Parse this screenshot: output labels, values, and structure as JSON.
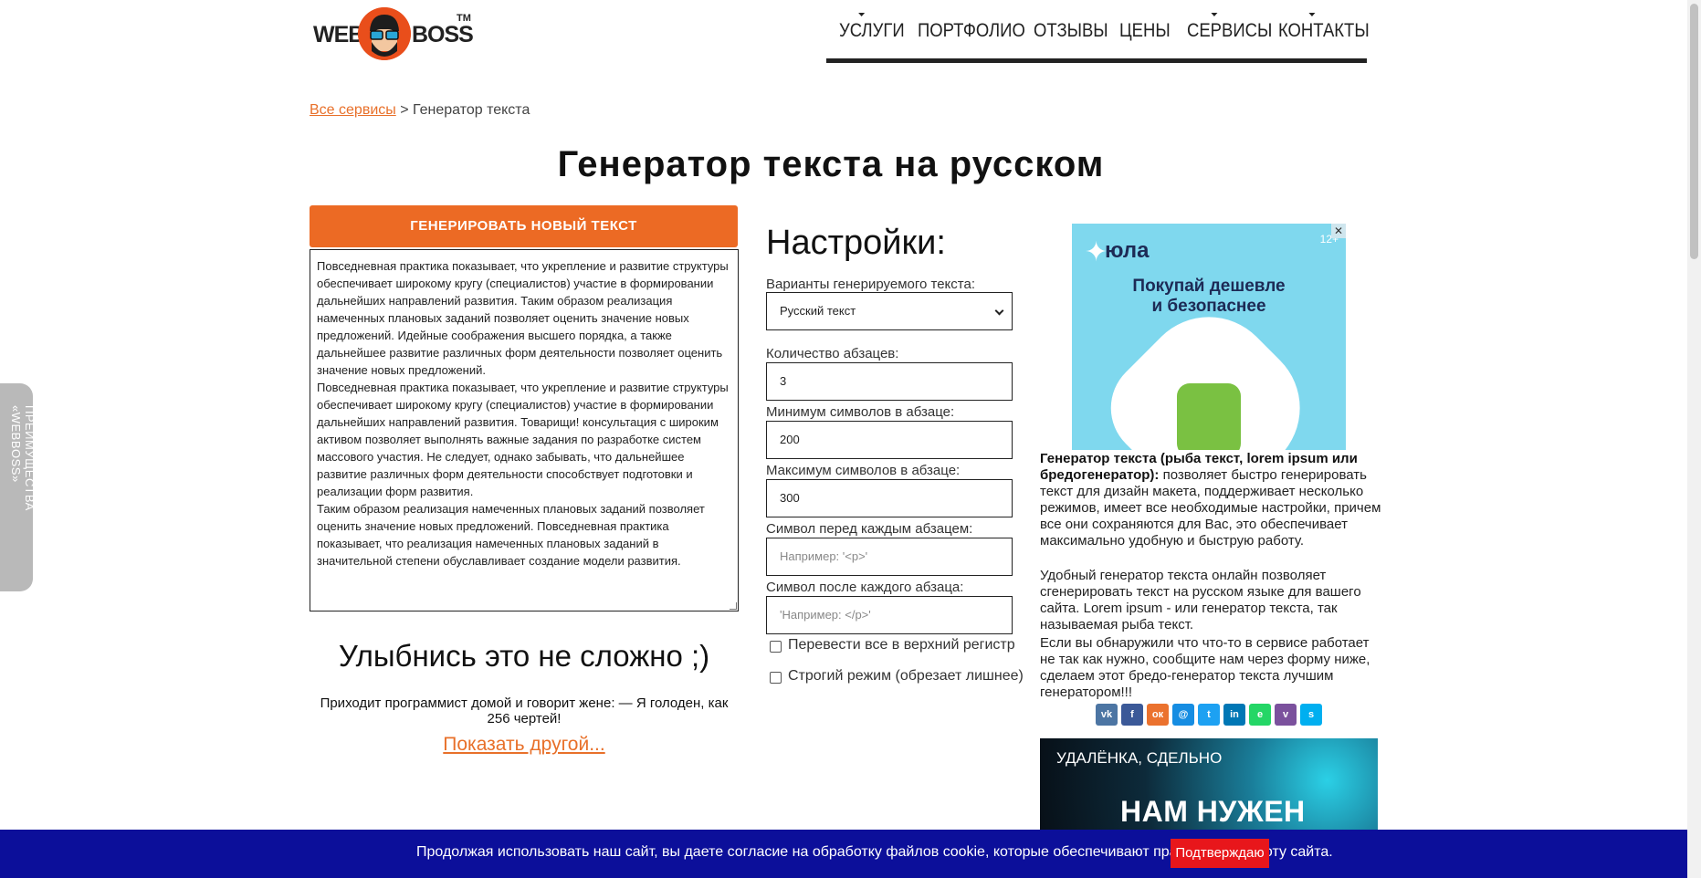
{
  "header": {
    "logo_left": "WEB",
    "logo_right": "BOSS",
    "logo_tm": "TM",
    "nav": [
      {
        "label": "УСЛУГИ",
        "has_dropdown": true
      },
      {
        "label": "ПОРТФОЛИО",
        "has_dropdown": false
      },
      {
        "label": "ОТЗЫВЫ",
        "has_dropdown": false
      },
      {
        "label": "ЦЕНЫ",
        "has_dropdown": false
      },
      {
        "label": "СЕРВИСЫ",
        "has_dropdown": true
      },
      {
        "label": "КОНТАКТЫ",
        "has_dropdown": true
      }
    ]
  },
  "breadcrumb": {
    "link": "Все сервисы",
    "separator": ">",
    "current": "Генератор текста"
  },
  "page_title": "Генератор текста на русском",
  "generator": {
    "button_label": "ГЕНЕРИРОВАТЬ НОВЫЙ ТЕКСТ",
    "paragraphs": [
      "Повседневная практика показывает, что укрепление и развитие структуры обеспечивает широкому кругу (специалистов) участие в формировании дальнейших направлений развития. Таким образом реализация намеченных плановых заданий позволяет оценить значение новых предложений. Идейные соображения высшего порядка, а также дальнейшее развитие различных форм деятельности позволяет оценить значение новых предложений.",
      "Повседневная практика показывает, что укрепление и развитие структуры обеспечивает широкому кругу (специалистов) участие в формировании дальнейших направлений развития. Товарищи! консультация с широким активом позволяет выполнять важные задания по разработке систем массового участия. Не следует, однако забывать, что дальнейшее развитие различных форм деятельности способствует подготовки и реализации форм развития.",
      "Таким образом реализация намеченных плановых заданий позволяет оценить значение новых предложений. Повседневная практика показывает, что реализация намеченных плановых заданий в значительной степени обуславливает создание модели развития."
    ]
  },
  "joke": {
    "title": "Улыбнись это не сложно ;)",
    "text": "Приходит программист домой и говорит жене: — Я голоден, как 256 чертей!",
    "more_link": "Показать другой..."
  },
  "settings": {
    "title": "Настройки:",
    "variant_label": "Варианты генерируемого текста:",
    "variant_value": "Русский текст",
    "paragraphs_label": "Количество абзацев:",
    "paragraphs_value": "3",
    "min_label": "Минимум символов в абзаце:",
    "min_value": "200",
    "max_label": "Максимум символов в абзаце:",
    "max_value": "300",
    "before_label": "Символ перед каждым абзацем:",
    "before_placeholder": "Например: '<p>'",
    "after_label": "Символ после каждого абзаца:",
    "after_placeholder": "'Например: </p>'",
    "uppercase_label": "Перевести все в верхний регистр",
    "uppercase_checked": false,
    "strict_label": "Строгий режим (обрезает лишнее)",
    "strict_checked": false
  },
  "ad": {
    "brand": "юла",
    "age": "12+",
    "close": "✕",
    "text": "Покупай дешевле\nи безопаснее"
  },
  "description": {
    "p1_bold": "Генератор текста (рыба текст, lorem ipsum или бредогенератор):",
    "p1_rest": " позволяет быстро генерировать текст для дизайн макета, поддерживает несколько режимов, имеет все необходимые настройки, причем все они сохраняются для Вас, это обеспечивает максимально удобную и быструю работу.",
    "p2": "Удобный генератор текста онлайн позволяет сгенерировать текст на русском языке для вашего сайта. Lorem ipsum - или генератор текста, так называемая рыба текст.",
    "p3": "Если вы обнаружили что что-то в сервисе работает не так как нужно, сообщите нам через форму ниже, сделаем этот бредо-генератор текста лучшим генератором!!!"
  },
  "share": [
    {
      "name": "vk-icon",
      "glyph": "vk",
      "color": "#4c75a3"
    },
    {
      "name": "facebook-icon",
      "glyph": "f",
      "color": "#3b5998"
    },
    {
      "name": "odnoklassniki-icon",
      "glyph": "ок",
      "color": "#eb722e"
    },
    {
      "name": "moimir-icon",
      "glyph": "@",
      "color": "#168de2"
    },
    {
      "name": "twitter-icon",
      "glyph": "t",
      "color": "#1da1f2"
    },
    {
      "name": "linkedin-icon",
      "glyph": "in",
      "color": "#0077b5"
    },
    {
      "name": "evernote-icon",
      "glyph": "e",
      "color": "#24d666"
    },
    {
      "name": "viber-icon",
      "glyph": "v",
      "color": "#7b519d"
    },
    {
      "name": "skype-icon",
      "glyph": "s",
      "color": "#00aff0"
    }
  ],
  "banner": {
    "line1": "УДАЛЁНКА, СДЕЛЬНО",
    "line2": "НАМ НУЖЕН"
  },
  "sidetab": "ПРЕИМУЩЕСТВА «WEBBOSS»",
  "cookie": {
    "text": "Продолжая использовать наш сайт, вы даете согласие на обработку файлов cookie, которые обеспечивают правильную работу сайта.",
    "button": "Подтверждаю"
  },
  "colors": {
    "accent": "#ec6a24",
    "link": "#e8702a",
    "cookie_bar": "#0c0f9a",
    "cookie_button": "#e8161b"
  }
}
